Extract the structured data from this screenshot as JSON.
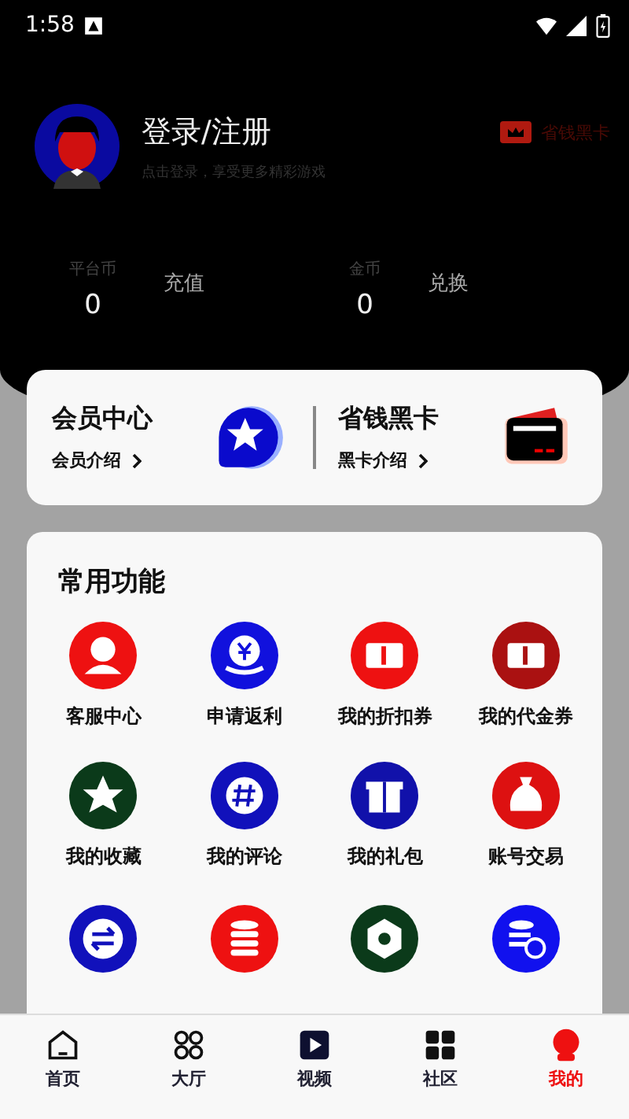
{
  "status_bar": {
    "time": "1:58"
  },
  "profile": {
    "name": "登录/注册",
    "subtitle": "点击登录，享受更多精彩游戏",
    "card_link": "省钱黑卡"
  },
  "balances": [
    {
      "label": "平台币",
      "value": "0",
      "action": "充值"
    },
    {
      "label": "金币",
      "value": "0",
      "action": "兑换"
    }
  ],
  "promos": [
    {
      "kind": "member",
      "title": "会员中心",
      "link": "会员介绍"
    },
    {
      "kind": "card",
      "title": "省钱黑卡",
      "link": "黑卡介绍"
    }
  ],
  "functions": {
    "title": "常用功能",
    "items": [
      {
        "label": "客服中心"
      },
      {
        "label": "申请返利"
      },
      {
        "label": "我的折扣券"
      },
      {
        "label": "我的代金券"
      },
      {
        "label": "我的收藏"
      },
      {
        "label": "我的评论"
      },
      {
        "label": "我的礼包"
      },
      {
        "label": "账号交易"
      },
      {
        "kind": "cut"
      },
      {
        "kind": "cut"
      },
      {
        "kind": "cut"
      },
      {
        "kind": "cut"
      }
    ]
  },
  "tabs": [
    {
      "label": "首页",
      "selected": false
    },
    {
      "label": "大厅",
      "selected": false
    },
    {
      "label": "视频",
      "selected": false
    },
    {
      "label": "社区",
      "selected": false
    },
    {
      "label": "我的",
      "selected": true
    }
  ]
}
